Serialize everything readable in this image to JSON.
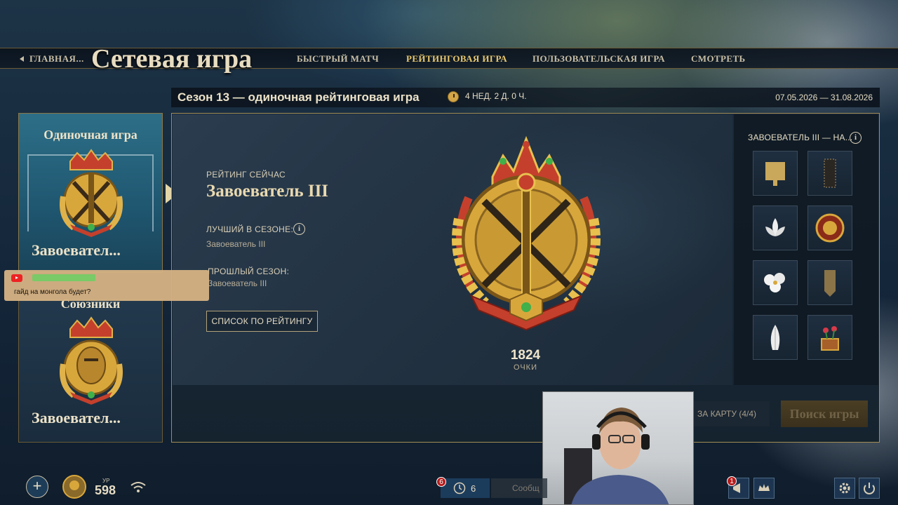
{
  "nav": {
    "back_label": "ГЛАВНАЯ...",
    "title": "Сетевая игра",
    "tabs": [
      {
        "label": "БЫСТРЫЙ МАТЧ",
        "active": false
      },
      {
        "label": "РЕЙТИНГОВАЯ ИГРА",
        "active": true
      },
      {
        "label": "ПОЛЬЗОВАТЕЛЬСКАЯ ИГРА",
        "active": false
      },
      {
        "label": "СМОТРЕТЬ",
        "active": false
      }
    ]
  },
  "season": {
    "title": "Сезон 13 — одиночная рейтинговая игра",
    "remaining": "4 НЕД. 2 Д. 0 Ч.",
    "dates": "07.05.2026 — 31.08.2026"
  },
  "modes": [
    {
      "title": "Одиночная игра",
      "rank": "Завоевател...",
      "selected": true
    },
    {
      "title": "Союзники",
      "rank": "Завоевател...",
      "selected": false
    }
  ],
  "rank": {
    "current_label": "РЕЙТИНГ СЕЙЧАС",
    "current_value": "Завоеватель III",
    "best_label": "ЛУЧШИЙ В СЕЗОНЕ:",
    "best_value": "Завоеватель III",
    "last_label": "ПРОШЛЫЙ СЕЗОН:",
    "last_value": "Завоеватель III",
    "leaderboard_button": "СПИСОК ПО РЕЙТИНГУ",
    "points": "1824",
    "points_label": "ОЧКИ"
  },
  "rewards": {
    "title": "ЗАВОЕВАТЕЛЬ III — НА...",
    "items": [
      {
        "icon": "scroll-banner-icon"
      },
      {
        "icon": "dark-pattern-banner-icon"
      },
      {
        "icon": "white-lotus-icon"
      },
      {
        "icon": "golden-portrait-icon"
      },
      {
        "icon": "white-flowers-icon"
      },
      {
        "icon": "tan-pennant-icon"
      },
      {
        "icon": "white-feather-icon"
      },
      {
        "icon": "flower-chest-icon"
      }
    ]
  },
  "actions": {
    "map_vote": "ЗА КАРТУ (4/4)",
    "find_game": "Поиск игры"
  },
  "chat": {
    "message": "гайд на монгола будет?"
  },
  "bottom": {
    "level_label": "УР",
    "level": "598",
    "friends_badge": "6",
    "friends_count": "6",
    "message_placeholder": "Сообщ",
    "alert_badge": "1"
  },
  "colors": {
    "accent_gold": "#e9c86f",
    "frame_gold": "#a38c55",
    "selected_card": "#2d6f87"
  }
}
